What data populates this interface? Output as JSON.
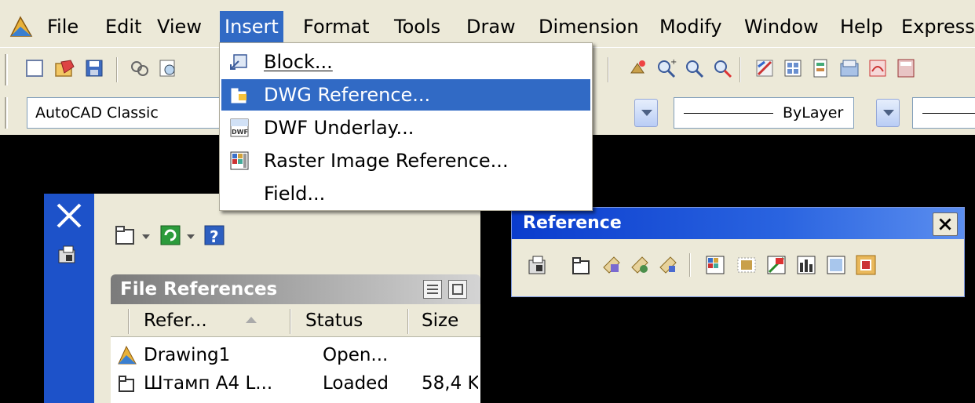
{
  "menubar": {
    "items": [
      "File",
      "Edit",
      "View",
      "Insert",
      "Format",
      "Tools",
      "Draw",
      "Dimension",
      "Modify",
      "Window",
      "Help",
      "Express"
    ],
    "active": "Insert"
  },
  "workspace_toolbar": {
    "workspace_combo": "AutoCAD Classic",
    "linetype_combo": "ByLayer"
  },
  "insert_menu": {
    "items": [
      {
        "label": "Block...",
        "icon": "block-icon",
        "mnemonic": "B"
      },
      {
        "label": "DWG Reference...",
        "icon": "dwg-reference-icon",
        "selected": true
      },
      {
        "label": "DWF Underlay...",
        "icon": "dwf-underlay-icon",
        "icon_text": "DWF"
      },
      {
        "label": "Raster Image Reference...",
        "icon": "raster-image-icon",
        "mnemonic": "I"
      },
      {
        "label": "Field...",
        "icon": null
      }
    ]
  },
  "xref_palette": {
    "panel_title": "File References",
    "columns": [
      "Refer...",
      "Status",
      "Size"
    ],
    "rows": [
      {
        "name": "Drawing1",
        "status": "Open...",
        "size": "",
        "icon": "drawing-icon"
      },
      {
        "name": "Штамп А4 L...",
        "status": "Loaded",
        "size": "58,4 K",
        "icon": "xref-attach-icon"
      }
    ]
  },
  "reference_toolbar": {
    "title": "Reference",
    "icons": [
      "external-references-icon",
      "attach-xref-icon",
      "clip-xref-icon",
      "xref-edge-frame-icon",
      "xbind-icon",
      "attach-image-icon",
      "image-clip-icon",
      "image-adjust-icon",
      "image-quality-icon",
      "image-transparency-icon",
      "image-frame-icon"
    ]
  },
  "colors": {
    "menu_highlight": "#316ac5",
    "chrome": "#ece9d8",
    "palette_strip": "#1d52c9",
    "titlebar": "#0a3ccd",
    "canvas": "#000000"
  }
}
